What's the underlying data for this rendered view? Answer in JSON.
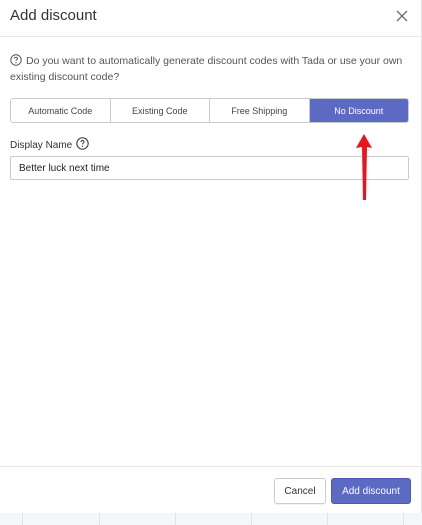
{
  "dialog": {
    "title": "Add discount",
    "info_text": "Do you want to automatically generate discount codes with Tada or use your own existing discount code?"
  },
  "tabs": [
    {
      "label": "Automatic Code",
      "active": false
    },
    {
      "label": "Existing Code",
      "active": false
    },
    {
      "label": "Free Shipping",
      "active": false
    },
    {
      "label": "No Discount",
      "active": true
    }
  ],
  "display_name": {
    "label": "Display Name",
    "value": "Better luck next time"
  },
  "footer": {
    "cancel_label": "Cancel",
    "add_label": "Add discount"
  },
  "colors": {
    "accent": "#5c6ac4",
    "annotation_arrow": "#e8161a"
  },
  "icons": {
    "close": "close-icon",
    "info": "question-circle-icon",
    "help": "question-circle-icon"
  }
}
